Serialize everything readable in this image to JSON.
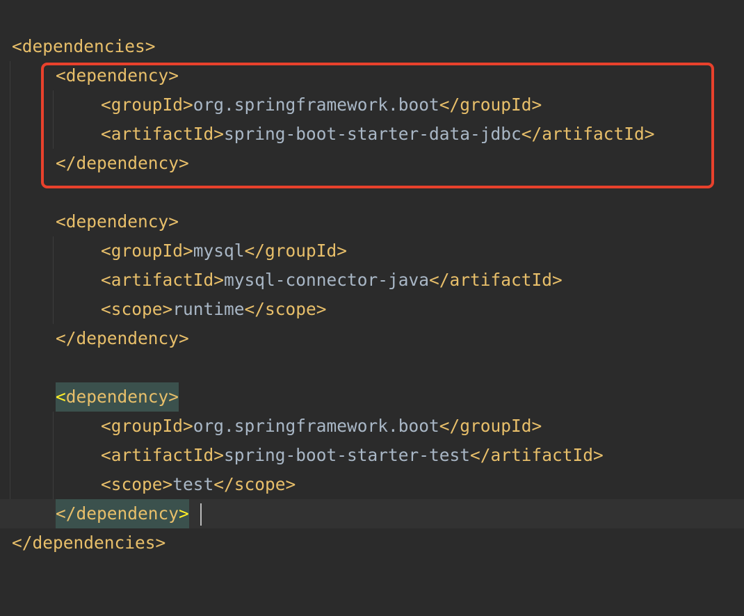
{
  "editor": {
    "lines": [
      {
        "id": "l1",
        "open": "<dependencies>"
      },
      {
        "id": "l2",
        "open": "<dependency>"
      },
      {
        "id": "l3",
        "open": "<groupId>",
        "value": "org.springframework.boot",
        "close": "</groupId>"
      },
      {
        "id": "l4",
        "open": "<artifactId>",
        "value": "spring-boot-starter-data-jdbc",
        "close": "</artifactId>"
      },
      {
        "id": "l5",
        "open": "</dependency>"
      },
      {
        "id": "l6",
        "open": "<dependency>"
      },
      {
        "id": "l7",
        "open": "<groupId>",
        "value": "mysql",
        "close": "</groupId>"
      },
      {
        "id": "l8",
        "open": "<artifactId>",
        "value": "mysql-connector-java",
        "close": "</artifactId>"
      },
      {
        "id": "l9",
        "open": "<scope>",
        "value": "runtime",
        "close": "</scope>"
      },
      {
        "id": "l10",
        "open": "</dependency>"
      },
      {
        "id": "l11",
        "open_bracket": "<",
        "open_rest": "dependency>"
      },
      {
        "id": "l12",
        "open": "<groupId>",
        "value": "org.springframework.boot",
        "close": "</groupId>"
      },
      {
        "id": "l13",
        "open": "<artifactId>",
        "value": "spring-boot-starter-test",
        "close": "</artifactId>"
      },
      {
        "id": "l14",
        "open": "<scope>",
        "value": "test",
        "close": "</scope>"
      },
      {
        "id": "l15",
        "open_rest": "</dependency",
        "open_bracket": ">"
      },
      {
        "id": "l16",
        "open": "</dependencies>"
      }
    ]
  },
  "colors": {
    "background": "#2b2b2b",
    "tag": "#e8bf6a",
    "text": "#a9b7c6",
    "tag_match_background": "#3b514d",
    "bracket_highlight": "#ffef28",
    "annotation_box": "#e8412c"
  }
}
